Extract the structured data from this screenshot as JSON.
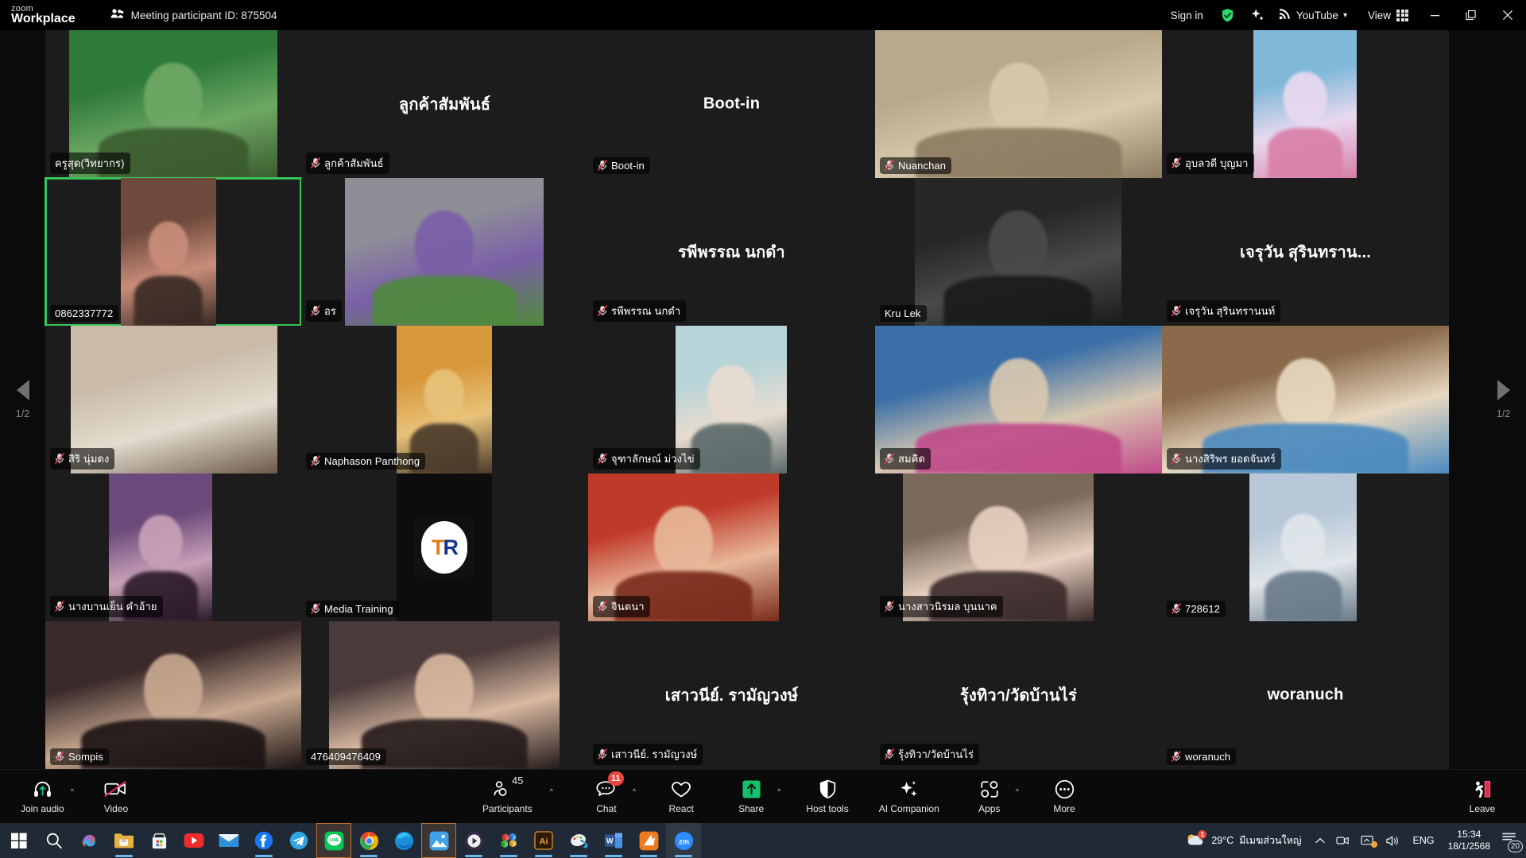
{
  "titlebar": {
    "brand_top": "zoom",
    "brand_bottom": "Workplace",
    "participant_id": "Meeting participant ID: 875504",
    "sign_in": "Sign in",
    "youtube": "YouTube",
    "view": "View",
    "icons": {
      "participants": "people-icon",
      "security_shield": "green-shield-check-icon",
      "ai_sparkle": "ai-sparkle-icon",
      "youtube_broadcast": "broadcast-icon",
      "chevron": "chevron-down-icon",
      "view_grid": "grid-view-icon",
      "minimize": "minimize-icon",
      "maximize": "maximize-icon",
      "close": "close-icon"
    }
  },
  "stage": {
    "page_left_label": "1/2",
    "page_right_label": "1/2",
    "prev_icon": "chevron-left-icon",
    "next_icon": "chevron-right-icon",
    "accent_active": "#38c45a",
    "tiles": [
      {
        "name": "ครูสุด(วิทยากร)",
        "big": "",
        "video": true,
        "muted": false,
        "active": false
      },
      {
        "name": "ลูกค้าสัมพันธ์",
        "big": "ลูกค้าสัมพันธ์",
        "video": false,
        "muted": true,
        "active": false
      },
      {
        "name": "Boot-in",
        "big": "Boot-in",
        "video": false,
        "muted": true,
        "active": false
      },
      {
        "name": "Nuanchan",
        "big": "",
        "video": true,
        "muted": true,
        "active": false
      },
      {
        "name": "อุบลวดี บุญมา",
        "big": "",
        "video": true,
        "muted": true,
        "active": false
      },
      {
        "name": "0862337772",
        "big": "",
        "video": true,
        "muted": false,
        "active": true
      },
      {
        "name": "อร",
        "big": "",
        "video": true,
        "muted": true,
        "active": false
      },
      {
        "name": "รพีพรรณ นกดำ",
        "big": "รพีพรรณ นกดำ",
        "video": false,
        "muted": true,
        "active": false
      },
      {
        "name": "Kru Lek",
        "big": "",
        "video": true,
        "muted": false,
        "active": false
      },
      {
        "name": "เจรุวัน สุรินทรานนท์",
        "big": "เจรุวัน  สุรินทราน...",
        "video": false,
        "muted": true,
        "active": false
      },
      {
        "name": "สิริ นุ่มดง",
        "big": "",
        "video": true,
        "muted": true,
        "active": false
      },
      {
        "name": "Naphason  Panthong",
        "big": "",
        "video": true,
        "muted": true,
        "active": false
      },
      {
        "name": "จุฑาลักษณ์  ม่วงไข่",
        "big": "",
        "video": true,
        "muted": true,
        "active": false
      },
      {
        "name": "สมคิด",
        "big": "",
        "video": true,
        "muted": true,
        "active": false
      },
      {
        "name": "นางสิริพร  ยอดจันทร์",
        "big": "",
        "video": true,
        "muted": true,
        "active": false
      },
      {
        "name": "นางบานเย็น คำอ้าย",
        "big": "",
        "video": true,
        "muted": true,
        "active": false
      },
      {
        "name": "Media Training",
        "big": "",
        "video": true,
        "muted": true,
        "active": false
      },
      {
        "name": "จินตนา",
        "big": "",
        "video": true,
        "muted": true,
        "active": false
      },
      {
        "name": "นางสาวนิรมล บุนนาค",
        "big": "",
        "video": true,
        "muted": true,
        "active": false
      },
      {
        "name": "728612",
        "big": "",
        "video": true,
        "muted": true,
        "active": false
      },
      {
        "name": "Sompis",
        "big": "",
        "video": true,
        "muted": true,
        "active": false
      },
      {
        "name": "476409476409",
        "big": "",
        "video": true,
        "muted": false,
        "active": false
      },
      {
        "name": "เสาวนีย์. รามัญวงษ์",
        "big": "เสาวนีย์. รามัญวงษ์",
        "video": false,
        "muted": true,
        "active": false
      },
      {
        "name": "รุ้งทิวา/วัดบ้านไร่",
        "big": "รุ้งทิวา/วัดบ้านไร่",
        "video": false,
        "muted": true,
        "active": false
      },
      {
        "name": "woranuch",
        "big": "woranuch",
        "video": false,
        "muted": true,
        "active": false
      }
    ]
  },
  "toolbar": {
    "join_audio": "Join audio",
    "video": "Video",
    "participants": "Participants",
    "participants_count": "45",
    "chat": "Chat",
    "chat_badge": "11",
    "react": "React",
    "share": "Share",
    "host_tools": "Host tools",
    "ai_companion": "AI Companion",
    "apps": "Apps",
    "more": "More",
    "leave": "Leave",
    "share_accent": "#16c06a",
    "leave_accent": "#e02d4a",
    "icons": {
      "join_audio": "headset-icon",
      "video": "camera-off-icon",
      "participants": "people-icon",
      "chat": "chat-bubble-icon",
      "react": "heart-icon",
      "share": "share-screen-icon",
      "host_tools": "shield-icon",
      "ai_companion": "ai-sparkle-icon",
      "apps": "apps-icon",
      "more": "more-dots-icon",
      "leave": "leave-door-icon",
      "caret": "chevron-up-icon"
    }
  },
  "taskbar": {
    "items": [
      {
        "name": "start-button",
        "icon": "windows-logo-icon"
      },
      {
        "name": "search-button",
        "icon": "search-icon"
      },
      {
        "name": "copilot-button",
        "icon": "copilot-icon"
      },
      {
        "name": "file-explorer-button",
        "icon": "folder-icon",
        "running": true
      },
      {
        "name": "microsoft-store-button",
        "icon": "store-icon"
      },
      {
        "name": "youtube-button",
        "icon": "youtube-icon"
      },
      {
        "name": "mail-button",
        "icon": "mail-icon"
      },
      {
        "name": "facebook-button",
        "icon": "facebook-icon",
        "running": true
      },
      {
        "name": "telegram-button",
        "icon": "telegram-icon"
      },
      {
        "name": "line-button",
        "icon": "line-icon",
        "highlight": true
      },
      {
        "name": "chrome-button",
        "icon": "chrome-icon",
        "running": true
      },
      {
        "name": "edge-button",
        "icon": "edge-icon"
      },
      {
        "name": "photos-button",
        "icon": "photos-icon",
        "highlight": true
      },
      {
        "name": "media-player-button",
        "icon": "play-circle-icon",
        "running": true
      },
      {
        "name": "3d-viewer-button",
        "icon": "blocks-icon",
        "running": true
      },
      {
        "name": "illustrator-button",
        "icon": "illustrator-icon",
        "running": true
      },
      {
        "name": "paint-button",
        "icon": "paint-icon",
        "running": true
      },
      {
        "name": "word-button",
        "icon": "word-icon",
        "running": true
      },
      {
        "name": "kingsoft-button",
        "icon": "orange-app-icon",
        "running": true
      },
      {
        "name": "zoom-taskbar-button",
        "icon": "zoom-icon",
        "running": true,
        "hl2": true
      }
    ],
    "tray": {
      "weather_temp": "29°C",
      "weather_text": "มีเมฆส่วนใหญ่",
      "weather_badge": "1",
      "language": "ENG",
      "time": "15:34",
      "date": "18/1/2568",
      "notif_count": "20",
      "icons": {
        "weather": "cloud-icon",
        "overflow": "chevron-up-icon",
        "camera": "camera-tray-icon",
        "screen_share": "screen-share-tray-icon",
        "volume": "speaker-icon",
        "notifications": "notification-center-icon"
      }
    }
  }
}
